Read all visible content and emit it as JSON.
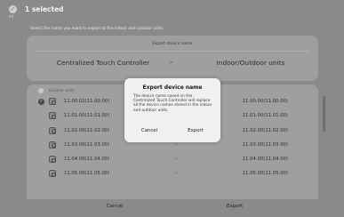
{
  "header": {
    "title": "1 selected",
    "select_all_label": "All",
    "subtitle": "Select the name you want to export to the indoor and outdoor units."
  },
  "export_panel": {
    "heading": "Export device name",
    "source": "Centralized Touch Controller",
    "arrow": ">",
    "target": "Indoor/Outdoor units"
  },
  "list": {
    "header_label": "Outdoor units",
    "rows": [
      {
        "left": "11.00.02(11.00.00)",
        "arrow": ">",
        "right": "11.00.00(11.00.00)",
        "checked": true
      },
      {
        "left": "11.01.00(11.01.00)",
        "arrow": ">",
        "right": "11.01.00(11.01.00)",
        "checked": false
      },
      {
        "left": "11.02.00(11.02.00)",
        "arrow": ">",
        "right": "11.02.00(11.02.00)",
        "checked": false
      },
      {
        "left": "11.03.00(11.03.00)",
        "arrow": ">",
        "right": "11.03.00(11.03.00)",
        "checked": false
      },
      {
        "left": "11.04.00(11.04.00)",
        "arrow": ">",
        "right": "11.04.00(11.04.00)",
        "checked": false
      },
      {
        "left": "11.05.00(11.05.00)",
        "arrow": ">",
        "right": "11.05.00(11.05.00)",
        "checked": false
      }
    ]
  },
  "footer": {
    "cancel_label": "Cancel",
    "export_label": "Export"
  },
  "dialog": {
    "title": "Export device name",
    "body": "The device name saved on the Centralized Touch Controller will replace all the device names stored in the indoor and outdoor units.",
    "cancel_label": "Cancel",
    "export_label": "Export"
  },
  "colors": {
    "background": "#8a8a8a",
    "panel": "#9f9f9f",
    "dialog": "#f0f0f0"
  }
}
